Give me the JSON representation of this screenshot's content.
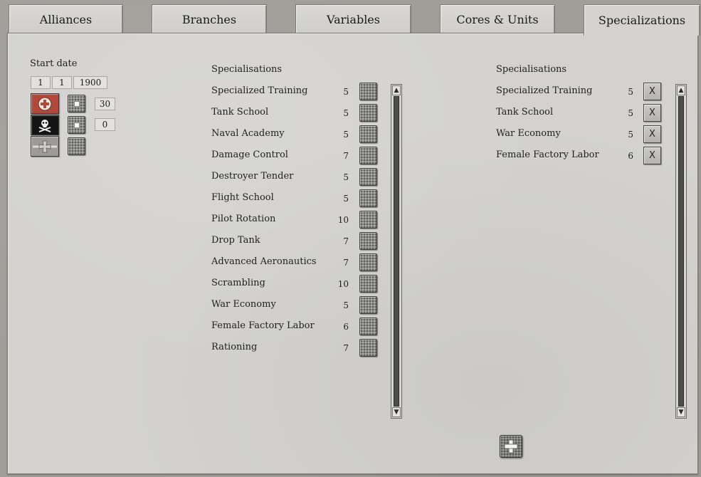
{
  "tabs": [
    {
      "label": "Alliances"
    },
    {
      "label": "Branches"
    },
    {
      "label": "Variables"
    },
    {
      "label": "Cores & Units"
    },
    {
      "label": "Specializations"
    }
  ],
  "left_panel": {
    "start_date_label": "Start date",
    "date": {
      "day": "1",
      "month": "1",
      "year": "1900"
    },
    "values": [
      "30",
      "0"
    ]
  },
  "available": {
    "header": "Specialisations",
    "items": [
      {
        "name": "Specialized Training",
        "cost": "5"
      },
      {
        "name": "Tank School",
        "cost": "5"
      },
      {
        "name": "Naval Academy",
        "cost": "5"
      },
      {
        "name": "Damage Control",
        "cost": "7"
      },
      {
        "name": "Destroyer Tender",
        "cost": "5"
      },
      {
        "name": "Flight School",
        "cost": "5"
      },
      {
        "name": "Pilot Rotation",
        "cost": "10"
      },
      {
        "name": "Drop Tank",
        "cost": "7"
      },
      {
        "name": "Advanced Aeronautics",
        "cost": "7"
      },
      {
        "name": "Scrambling",
        "cost": "10"
      },
      {
        "name": "War Economy",
        "cost": "5"
      },
      {
        "name": "Female Factory Labor",
        "cost": "6"
      },
      {
        "name": "Rationing",
        "cost": "7"
      }
    ]
  },
  "selected": {
    "header": "Specialisations",
    "remove_label": "X",
    "items": [
      {
        "name": "Specialized Training",
        "cost": "5"
      },
      {
        "name": "Tank School",
        "cost": "5"
      },
      {
        "name": "War Economy",
        "cost": "5"
      },
      {
        "name": "Female Factory Labor",
        "cost": "6"
      }
    ]
  },
  "scroll_arrows": {
    "up": "▲",
    "down": "▼"
  },
  "icons": [
    "medical-cross-flag-icon",
    "skull-flag-icon",
    "iron-cross-flag-icon",
    "add-icon"
  ]
}
